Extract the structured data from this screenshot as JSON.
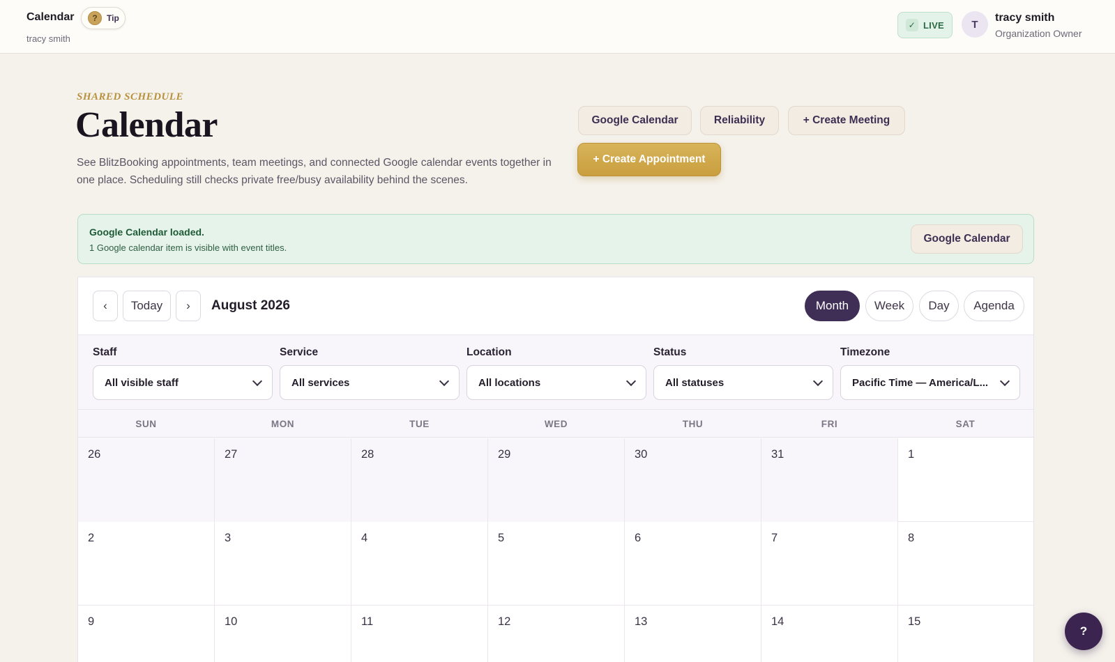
{
  "topbar": {
    "title": "Calendar",
    "subtitle": "tracy smith",
    "tip_label": "Tip",
    "tip_icon": "?",
    "live_label": "LIVE",
    "live_icon": "✓",
    "avatar_initial": "T",
    "user_name": "tracy smith",
    "user_role": "Organization Owner"
  },
  "header": {
    "eyebrow": "SHARED SCHEDULE",
    "title": "Calendar",
    "description": "See BlitzBooking appointments, team meetings, and connected Google calendar events together in one place. Scheduling still checks private free/busy availability behind the scenes.",
    "buttons": {
      "google_calendar": "Google Calendar",
      "reliability": "Reliability",
      "create_meeting": "+ Create Meeting",
      "create_appointment": "+ Create Appointment"
    }
  },
  "banner": {
    "title": "Google Calendar loaded.",
    "text": "1 Google calendar item is visible with event titles.",
    "button": "Google Calendar"
  },
  "calendar": {
    "prev": "‹",
    "today": "Today",
    "next": "›",
    "month_label": "August 2026",
    "views": [
      "Month",
      "Week",
      "Day",
      "Agenda"
    ],
    "active_view": "Month",
    "filters": [
      {
        "label": "Staff",
        "value": "All visible staff"
      },
      {
        "label": "Service",
        "value": "All services"
      },
      {
        "label": "Location",
        "value": "All locations"
      },
      {
        "label": "Status",
        "value": "All statuses"
      },
      {
        "label": "Timezone",
        "value": "Pacific Time — America/L..."
      }
    ],
    "weekdays": [
      "SUN",
      "MON",
      "TUE",
      "WED",
      "THU",
      "FRI",
      "SAT"
    ],
    "weeks": [
      [
        "26",
        "27",
        "28",
        "29",
        "30",
        "31",
        "1"
      ],
      [
        "2",
        "3",
        "4",
        "5",
        "6",
        "7",
        "8"
      ],
      [
        "9",
        "10",
        "11",
        "12",
        "13",
        "14",
        "15"
      ]
    ]
  },
  "help_label": "?",
  "colors": {
    "accent_gold": "#c99e3e",
    "primary_purple": "#3f2f57",
    "live_green": "#2d6a45",
    "banner_bg": "#e5f3ea"
  }
}
